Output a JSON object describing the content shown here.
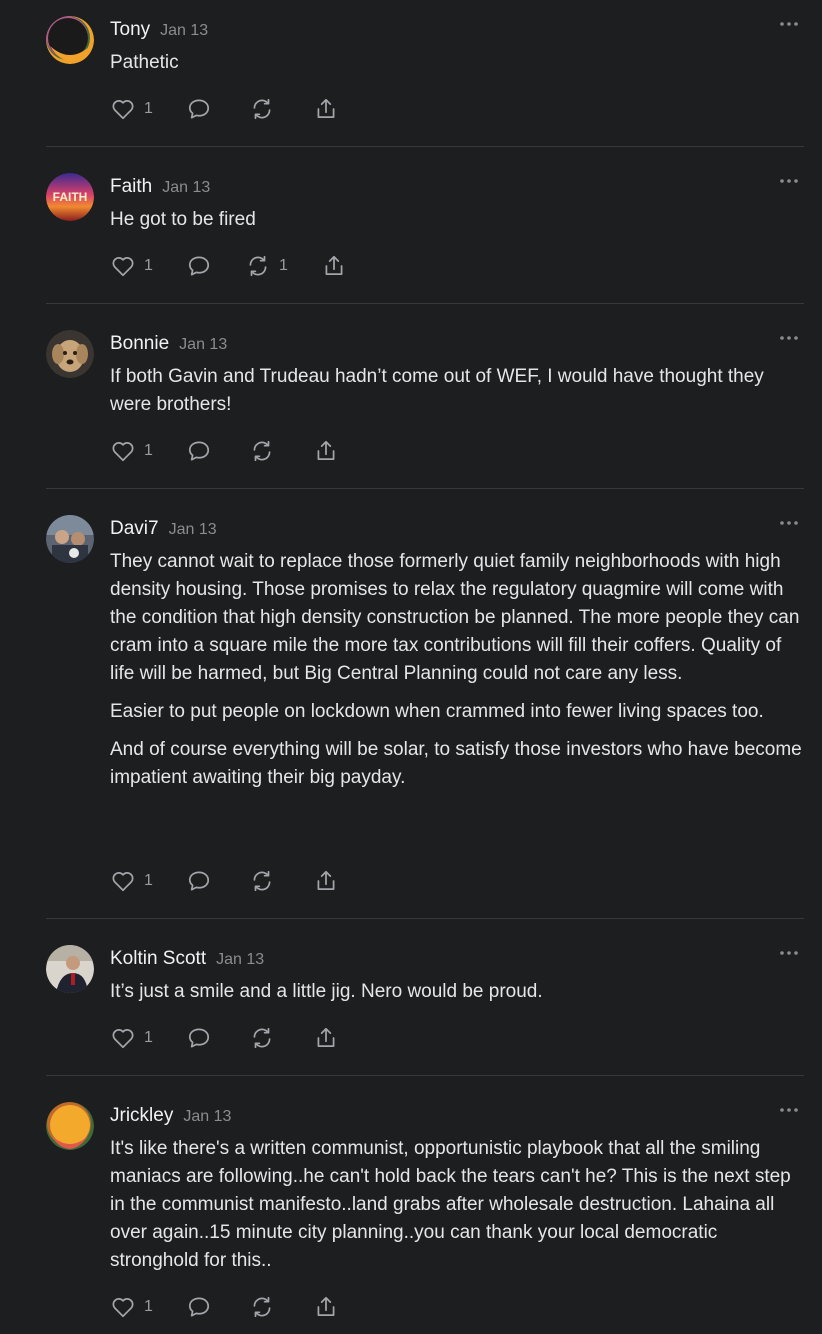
{
  "comments": [
    {
      "author": "Tony",
      "date": "Jan 13",
      "paragraphs": [
        "Pathetic"
      ],
      "likes": "1",
      "restacks": "",
      "avatar": "avatar-tony"
    },
    {
      "author": "Faith",
      "date": "Jan 13",
      "paragraphs": [
        "He got to be fired"
      ],
      "likes": "1",
      "restacks": "1",
      "avatar": "avatar-faith",
      "avatar_text": "FAITH"
    },
    {
      "author": "Bonnie",
      "date": "Jan 13",
      "paragraphs": [
        "If both Gavin and Trudeau hadn’t come out of WEF, I would have thought they were brothers!"
      ],
      "likes": "1",
      "restacks": "",
      "avatar": "avatar-dog"
    },
    {
      "author": "Davi7",
      "date": "Jan 13",
      "paragraphs": [
        "They cannot wait to replace those formerly quiet family neighborhoods with high density housing. Those promises to relax the regulatory quagmire will come with the condition that high density construction be planned. The more people they can cram into a square mile the more tax contributions will fill their coffers. Quality of life will be harmed, but Big Central Planning could not care any less.",
        "Easier to put people on lockdown when crammed into fewer living spaces too.",
        "And of course everything will be solar, to satisfy those investors who have become impatient awaiting their big payday."
      ],
      "likes": "1",
      "restacks": "",
      "avatar": "avatar-photo"
    },
    {
      "author": "Koltin Scott",
      "date": "Jan 13",
      "paragraphs": [
        "It’s just a smile and a little jig. Nero would be proud."
      ],
      "likes": "1",
      "restacks": "",
      "avatar": "avatar-photo"
    },
    {
      "author": "Jrickley",
      "date": "Jan 13",
      "paragraphs": [
        "It's like there's a written communist, opportunistic playbook that all the smiling maniacs are following..he can't hold back the tears can't he? This is the next step in the communist manifesto..land grabs after wholesale destruction. Lahaina all over again..15 minute city planning..you can thank your local democratic stronghold for this.."
      ],
      "likes": "1",
      "restacks": "",
      "avatar": "avatar-jrickley"
    }
  ],
  "icons": {
    "like": "heart-icon",
    "reply": "comment-bubble-icon",
    "restack": "restack-icon",
    "share": "share-icon",
    "more": "more-dots-icon"
  },
  "colors": {
    "background": "#1d1e20",
    "text": "#e6e6e8",
    "muted": "#8b8c90",
    "divider": "#37383c"
  }
}
